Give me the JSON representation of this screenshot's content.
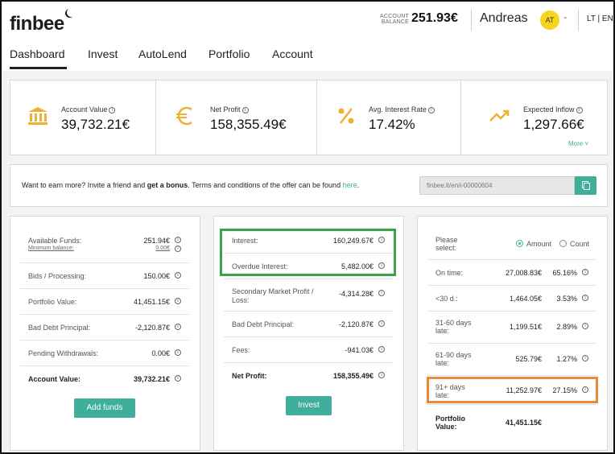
{
  "header": {
    "logo": "finbee",
    "balance_label_1": "ACCOUNT",
    "balance_label_2": "BALANCE",
    "balance_value": "251.93€",
    "user_name": "Andreas",
    "avatar_initials": "AT",
    "lang": "LT | EN"
  },
  "nav": {
    "items": [
      {
        "label": "Dashboard",
        "active": true
      },
      {
        "label": "Invest"
      },
      {
        "label": "AutoLend"
      },
      {
        "label": "Portfolio"
      },
      {
        "label": "Account"
      }
    ]
  },
  "stats": [
    {
      "icon": "bank-icon",
      "label": "Account Value",
      "value": "39,732.21€"
    },
    {
      "icon": "euro-icon",
      "label": "Net Profit",
      "value": "158,355.49€"
    },
    {
      "icon": "percent-icon",
      "label": "Avg. Interest Rate",
      "value": "17.42%"
    },
    {
      "icon": "trend-up-icon",
      "label": "Expected Inflow",
      "value": "1,297.66€"
    }
  ],
  "stats_more": "More ˅",
  "invite": {
    "text_1": "Want to earn more? Invite a friend and ",
    "text_bold": "get a bonus",
    "text_2": ". Terms and conditions of the offer can be found ",
    "link": "here",
    "text_3": ".",
    "referral_link": "finbee.lt/en/i-00000604"
  },
  "funds_panel": {
    "rows": [
      {
        "label": "Available Funds:",
        "sub": "Minimum balance:",
        "value": "251.94€",
        "sub_value": "0.00€"
      },
      {
        "label": "Bids / Processing:",
        "value": "150.00€"
      },
      {
        "label": "Portfolio Value:",
        "value": "41,451.15€"
      },
      {
        "label": "Bad Debt Principal:",
        "value": "-2,120.87€"
      },
      {
        "label": "Pending Withdrawals:",
        "value": "0.00€"
      },
      {
        "label": "Account Value:",
        "value": "39,732.21€"
      }
    ],
    "button": "Add funds"
  },
  "profit_panel": {
    "rows": [
      {
        "label": "Interest:",
        "value": "160,249.67€"
      },
      {
        "label": "Overdue Interest:",
        "value": "5,482.00€"
      },
      {
        "label": "Secondary Market Profit / Loss:",
        "value": "-4,314.28€"
      },
      {
        "label": "Bad Debt Principal:",
        "value": "-2,120.87€"
      },
      {
        "label": "Fees:",
        "value": "-941.03€"
      },
      {
        "label": "Net Profit:",
        "value": "158,355.49€"
      }
    ],
    "button": "Invest"
  },
  "portfolio_panel": {
    "select_label": "Please select:",
    "option_amount": "Amount",
    "option_count": "Count",
    "rows": [
      {
        "label": "On time:",
        "amount": "27,008.83€",
        "pct": "65.16%"
      },
      {
        "label": "<30 d.:",
        "amount": "1,464.05€",
        "pct": "3.53%"
      },
      {
        "label": "31-60 days late:",
        "amount": "1,199.51€",
        "pct": "2.89%"
      },
      {
        "label": "61-90 days late:",
        "amount": "525.79€",
        "pct": "1.27%"
      },
      {
        "label": "91+ days late:",
        "amount": "11,252.97€",
        "pct": "27.15%"
      }
    ],
    "total_label": "Portfolio Value:",
    "total_value": "41,451.15€"
  },
  "colors": {
    "accent": "#3fae9a",
    "icon": "#f0b030",
    "highlight_green": "#3aa34a",
    "highlight_orange": "#ec8a30"
  }
}
